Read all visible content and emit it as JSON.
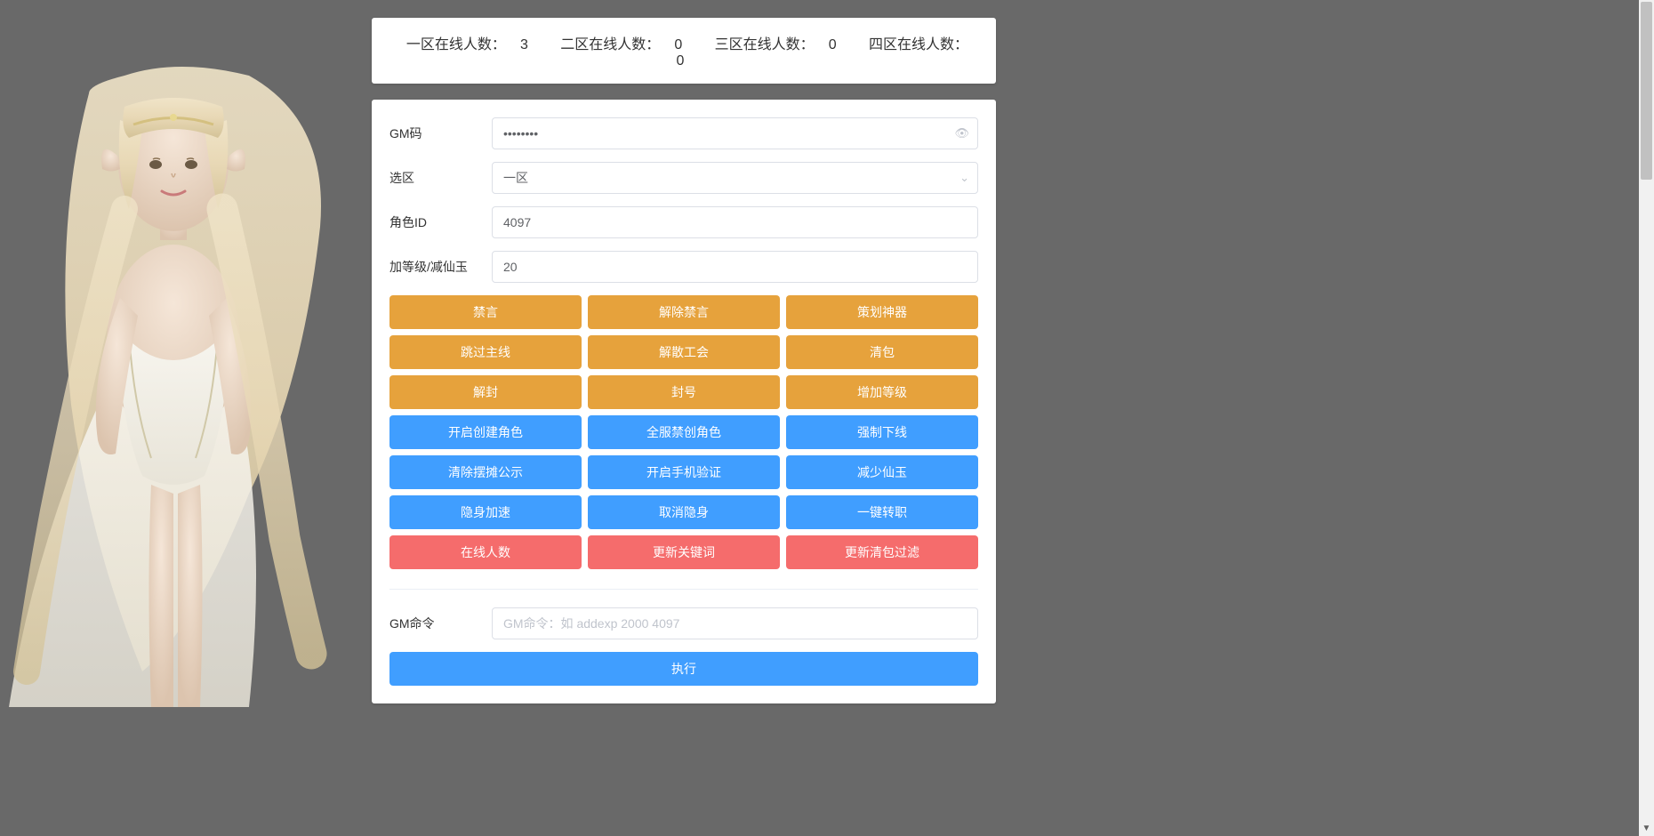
{
  "header": {
    "zone1_label": "一区在线人数：",
    "zone1_count": "3",
    "zone2_label": "二区在线人数：",
    "zone2_count": "0",
    "zone3_label": "三区在线人数：",
    "zone3_count": "0",
    "zone4_label": "四区在线人数：",
    "zone4_count": "0"
  },
  "form": {
    "gm_code_label": "GM码",
    "gm_code_value": "••••••••",
    "zone_label": "选区",
    "zone_value": "一区",
    "role_id_label": "角色ID",
    "role_id_value": "4097",
    "amount_label": "加等级/减仙玉",
    "amount_value": "20"
  },
  "buttons": {
    "row1": {
      "b1": "禁言",
      "b2": "解除禁言",
      "b3": "策划神器"
    },
    "row2": {
      "b1": "跳过主线",
      "b2": "解散工会",
      "b3": "清包"
    },
    "row3": {
      "b1": "解封",
      "b2": "封号",
      "b3": "增加等级"
    },
    "row4": {
      "b1": "开启创建角色",
      "b2": "全服禁创角色",
      "b3": "强制下线"
    },
    "row5": {
      "b1": "清除摆摊公示",
      "b2": "开启手机验证",
      "b3": "减少仙玉"
    },
    "row6": {
      "b1": "隐身加速",
      "b2": "取消隐身",
      "b3": "一键转职"
    },
    "row7": {
      "b1": "在线人数",
      "b2": "更新关键词",
      "b3": "更新清包过滤"
    }
  },
  "command": {
    "label": "GM命令",
    "placeholder": "GM命令：如 addexp 2000 4097",
    "execute": "执行"
  }
}
